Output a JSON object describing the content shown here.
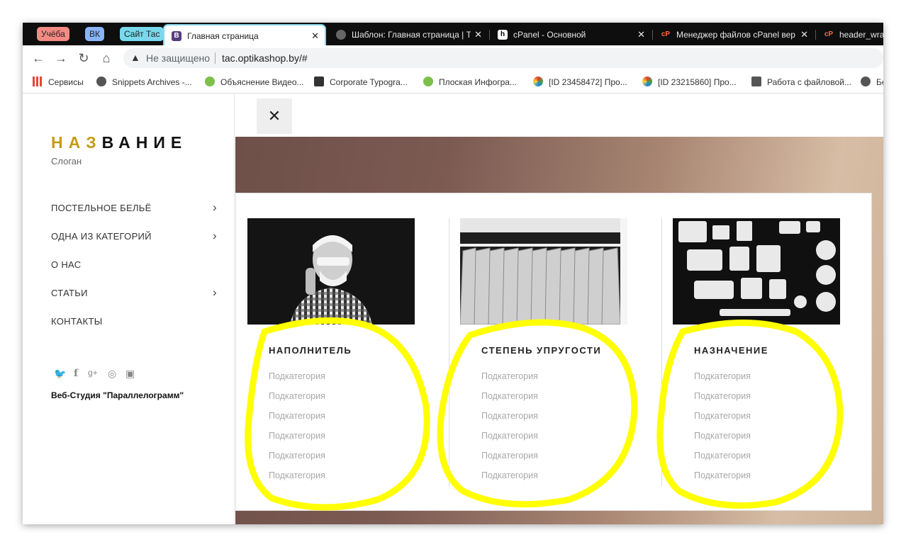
{
  "browser": {
    "tab_groups": [
      {
        "label": "Учёба",
        "color": "#f28b82"
      },
      {
        "label": "ВК",
        "color": "#8ab4f8"
      },
      {
        "label": "Сайт Тас",
        "color": "#78d9ec"
      }
    ],
    "tabs": [
      {
        "title": "Главная страница",
        "active": true
      },
      {
        "title": "Шаблон: Главная страница | Та",
        "active": false
      },
      {
        "title": "cPanel - Основной",
        "active": false
      },
      {
        "title": "Менеджер файлов cPanel вер",
        "active": false
      },
      {
        "title": "header_wra",
        "active": false
      }
    ],
    "address": {
      "security_label": "Не защищено",
      "url": "tac.optikashop.by/#"
    },
    "bookmarks": [
      {
        "label": "Сервисы"
      },
      {
        "label": "Snippets Archives -..."
      },
      {
        "label": "Объяснение Видео..."
      },
      {
        "label": "Corporate Typogra..."
      },
      {
        "label": "Плоская Инфогра..."
      },
      {
        "label": "[ID 23458472] Про..."
      },
      {
        "label": "[ID 23215860] Про..."
      },
      {
        "label": "Работа с файловой..."
      },
      {
        "label": "Бе"
      }
    ]
  },
  "site": {
    "logo_part1": "НАЗ",
    "logo_part2": "ВАНИЕ",
    "slogan": "Слоган",
    "menu": [
      {
        "label": "ПОСТЕЛЬНОЕ БЕЛЬЁ",
        "has_children": true
      },
      {
        "label": "ОДНА ИЗ КАТЕГОРИЙ",
        "has_children": true
      },
      {
        "label": "О НАС",
        "has_children": false
      },
      {
        "label": "СТАТЬИ",
        "has_children": true
      },
      {
        "label": "КОНТАКТЫ",
        "has_children": false
      }
    ],
    "social_icons": [
      "twitter-icon",
      "facebook-icon",
      "google-plus-icon",
      "dribbble-icon",
      "instagram-icon"
    ],
    "studio": "Веб-Студия \"Параллелограмм\"",
    "close_label": "✕",
    "columns": [
      {
        "title": "НАПОЛНИТЕЛЬ",
        "items": [
          "Подкатегория",
          "Подкатегория",
          "Подкатегория",
          "Подкатегория",
          "Подкатегория",
          "Подкатегория"
        ]
      },
      {
        "title": "СТЕПЕНЬ УПРУГОСТИ",
        "items": [
          "Подкатегория",
          "Подкатегория",
          "Подкатегория",
          "Подкатегория",
          "Подкатегория",
          "Подкатегория"
        ]
      },
      {
        "title": "НАЗНАЧЕНИЕ",
        "items": [
          "Подкатегория",
          "Подкатегория",
          "Подкатегория",
          "Подкатегория",
          "Подкатегория",
          "Подкатегория"
        ]
      }
    ]
  },
  "colors": {
    "accent": "#c59b17",
    "highlight": "#ffff00"
  }
}
